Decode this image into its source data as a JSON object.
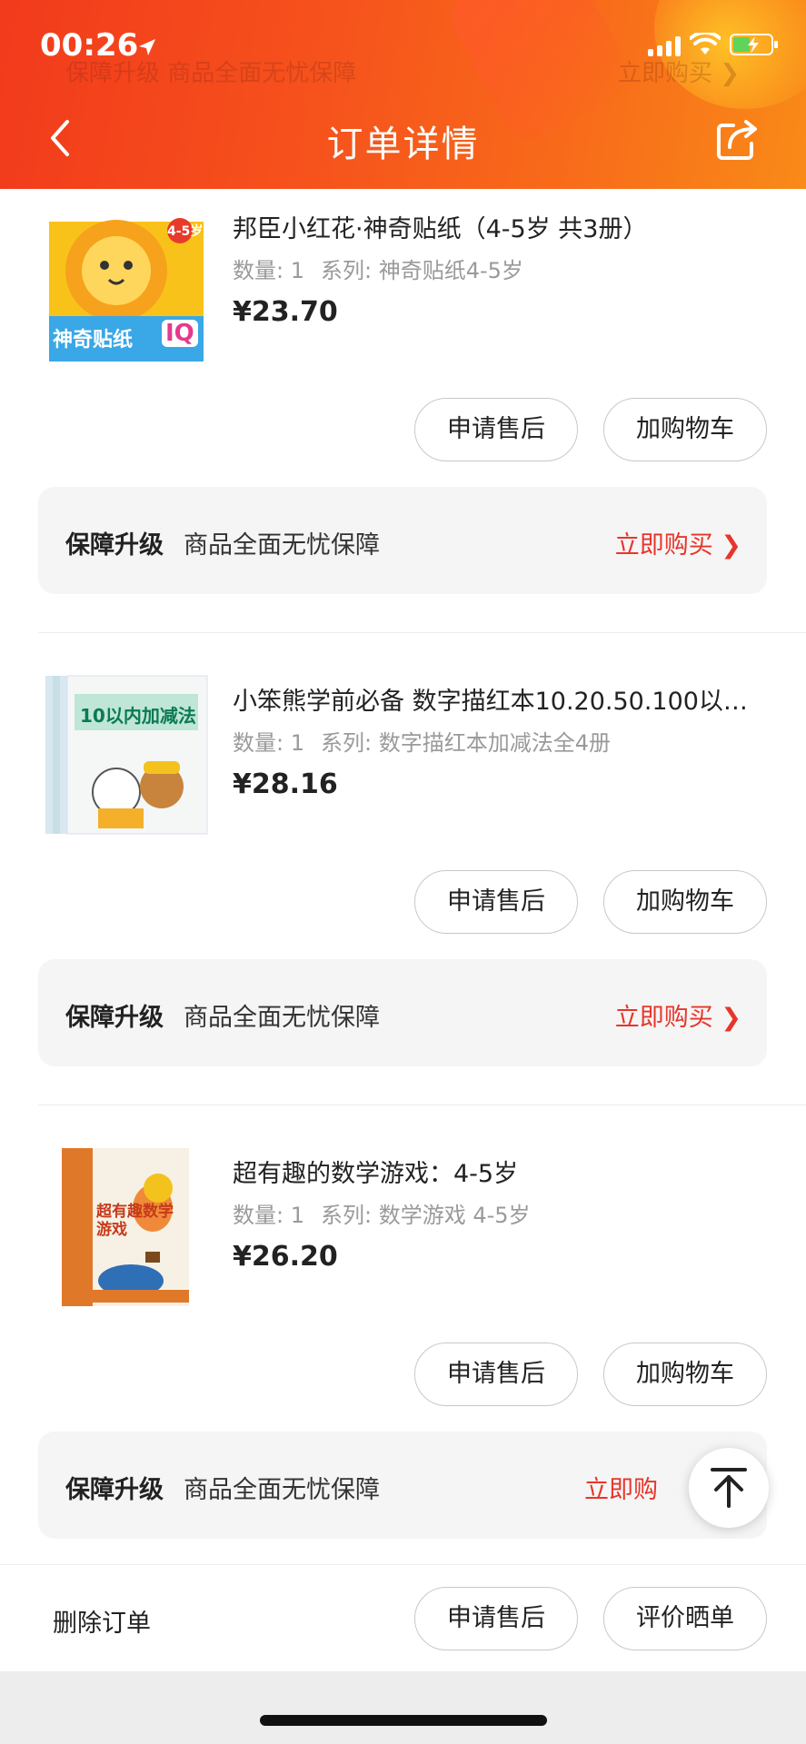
{
  "status_bar": {
    "time": "00:26"
  },
  "header": {
    "title": "订单详情",
    "ghost_left": "保障升级  商品全面无忧保障",
    "ghost_right": "立即购买 ❯"
  },
  "products": [
    {
      "title": "邦臣小红花·神奇贴纸（4-5岁 共3册）",
      "meta_qty": "数量: 1",
      "meta_series": "系列: 神奇贴纸4-5岁",
      "price": "¥23.70",
      "cover_text": "神奇贴纸",
      "cover_badge": "IQ",
      "cover_age": "4-5岁"
    },
    {
      "title": "小笨熊学前必备 数字描红本10.20.50.100以…",
      "meta_qty": "数量: 1",
      "meta_series": "系列: 数字描红本加减法全4册",
      "price": "¥28.16",
      "cover_text": "10以内加减法"
    },
    {
      "title": "超有趣的数学游戏：4-5岁",
      "meta_qty": "数量: 1",
      "meta_series": "系列: 数学游戏 4-5岁",
      "price": "¥26.20",
      "cover_text": "超有趣数学游戏"
    }
  ],
  "actions": {
    "after_sale": "申请售后",
    "add_cart": "加购物车"
  },
  "protect": {
    "title": "保障升级",
    "desc": "商品全面无忧保障",
    "buy": "立即购买 ❯",
    "buy_partial": "立即购"
  },
  "bottom": {
    "delete": "删除订单",
    "after_sale": "申请售后",
    "review": "评价晒单"
  },
  "colors": {
    "accent": "#e8352b",
    "header_start": "#f23a1c",
    "header_end": "#f98a18"
  }
}
